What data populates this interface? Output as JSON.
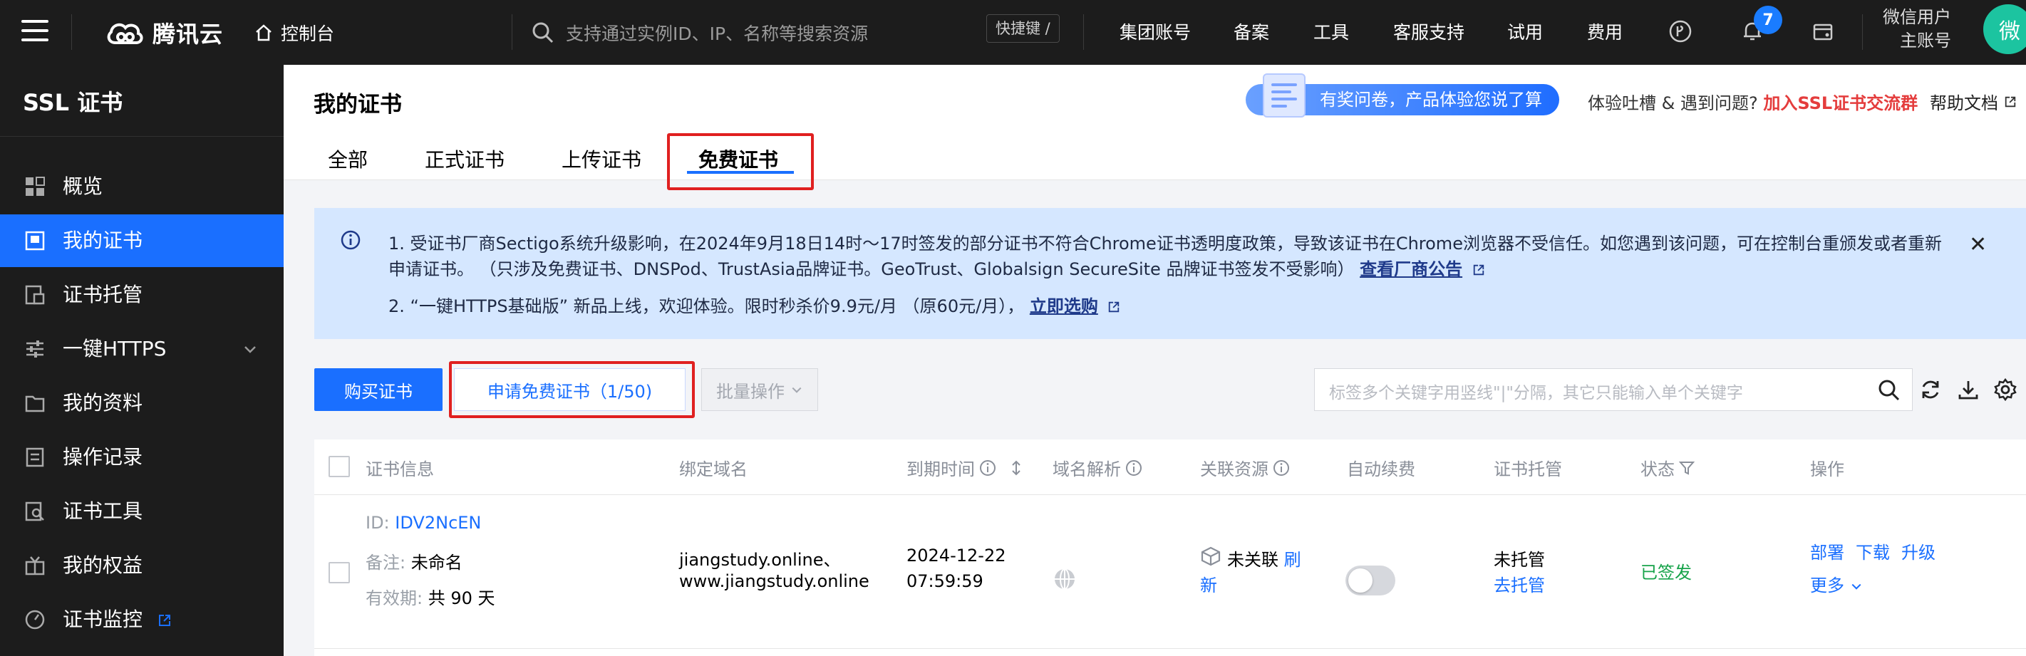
{
  "topbar": {
    "brand": "腾讯云",
    "console": "控制台",
    "search_placeholder": "支持通过实例ID、IP、名称等搜索资源",
    "shortcut": "快捷键 /",
    "nav": [
      "集团账号",
      "备案",
      "工具",
      "客服支持",
      "试用",
      "费用"
    ],
    "notification_count": "7",
    "user_line1": "微信用户",
    "user_line2": "主账号",
    "avatar_char": "微"
  },
  "sidebar": {
    "title": "SSL 证书",
    "items": [
      {
        "label": "概览",
        "icon": "grid-icon"
      },
      {
        "label": "我的证书",
        "icon": "certificate-icon"
      },
      {
        "label": "证书托管",
        "icon": "hosting-icon"
      },
      {
        "label": "一键HTTPS",
        "icon": "sliders-icon"
      },
      {
        "label": "我的资料",
        "icon": "folder-icon"
      },
      {
        "label": "操作记录",
        "icon": "document-icon"
      },
      {
        "label": "证书工具",
        "icon": "tool-icon"
      },
      {
        "label": "我的权益",
        "icon": "gift-icon"
      },
      {
        "label": "证书监控",
        "icon": "monitor-icon"
      }
    ]
  },
  "header": {
    "title": "我的证书",
    "survey_text": "有奖问卷，产品体验您说了算",
    "feedback_prefix": "体验吐槽 & 遇到问题?",
    "feedback_link": "加入SSL证书交流群",
    "help_docs": "帮助文档"
  },
  "tabs": [
    "全部",
    "正式证书",
    "上传证书",
    "免费证书"
  ],
  "notice": {
    "line1": "1. 受证书厂商Sectigo系统升级影响，在2024年9月18日14时～17时签发的部分证书不符合Chrome证书透明度政策，导致该证书在Chrome浏览器不受信任。如您遇到该问题，可在控制台重颁发或者重新",
    "line2": "申请证书。 （只涉及免费证书、DNSPod、TrustAsia品牌证书。GeoTrust、Globalsign SecureSite 品牌证书签发不受影响）",
    "line2_link": "查看厂商公告",
    "line3": "2. “一键HTTPS基础版” 新品上线，欢迎体验。限时秒杀价9.9元/月 （原60元/月），",
    "line3_link": "立即选购"
  },
  "toolbar": {
    "buy_label": "购买证书",
    "apply_label": "申请免费证书（1/50)",
    "batch_label": "批量操作",
    "search_placeholder": "标签多个关键字用竖线\"|\"分隔，其它只能输入单个关键字"
  },
  "table": {
    "headers": [
      "证书信息",
      "绑定域名",
      "到期时间",
      "域名解析",
      "关联资源",
      "自动续费",
      "证书托管",
      "状态",
      "操作"
    ],
    "row": {
      "id_label": "ID:",
      "id_value": "IDV2NcEN",
      "remark_label": "备注:",
      "remark_value": "未命名",
      "validity_label": "有效期:",
      "validity_value": "共 90 天",
      "domain1": "jiangstudy.online、",
      "domain2": "www.jiangstudy.online",
      "expire_date": "2024-12-22",
      "expire_time": "07:59:59",
      "resource_status": "未关联",
      "refresh1": "刷",
      "refresh2": "新",
      "hosting_status": "未托管",
      "hosting_link": "去托管",
      "status": "已签发",
      "actions": [
        "部署",
        "下载",
        "升级",
        "更多"
      ]
    }
  },
  "colors": {
    "accent": "#1a6fff",
    "highlight_box": "#e02020",
    "status_green": "#17a34a",
    "notice_bg": "#d5e7ff"
  }
}
